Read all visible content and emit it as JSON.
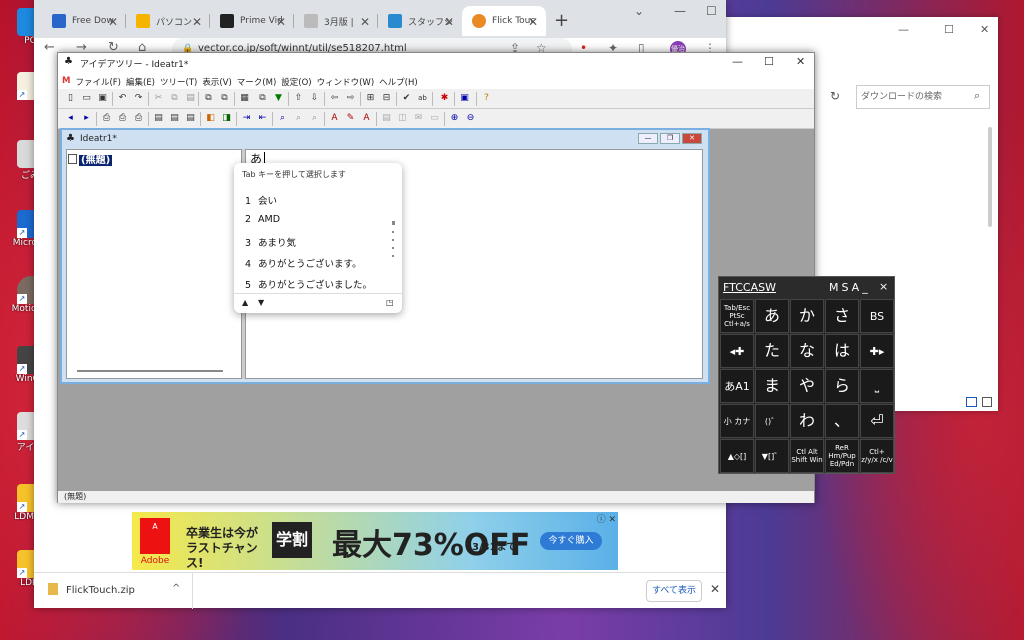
{
  "desktop": {
    "icons": [
      {
        "label": "PC",
        "color": "#1d8ae0"
      },
      {
        "label": "",
        "color": "#f6f0e0"
      },
      {
        "label": "ごみ",
        "color": "#d9d9d9"
      },
      {
        "label": "Microso",
        "color": "#1a6ad0"
      },
      {
        "label": "MotionA",
        "color": "#7a6a60"
      },
      {
        "label": "WinCo",
        "color": "#444"
      },
      {
        "label": "アイデ",
        "color": "#ddd"
      },
      {
        "label": "LDMult",
        "color": "#f6c22b"
      },
      {
        "label": "LDPl",
        "color": "#f6c22b"
      }
    ]
  },
  "chrome": {
    "tabs": [
      {
        "label": "Free Dow",
        "fav": "#2a66c9"
      },
      {
        "label": "パソコン - ",
        "fav": "#f5b400"
      },
      {
        "label": "Prime Vid",
        "fav": "#222"
      },
      {
        "label": "3月版 | ",
        "fav": "#bbb"
      },
      {
        "label": "スタッフシ",
        "fav": "#2a8ad0"
      },
      {
        "label": "Flick Touc",
        "fav": "#e98a24"
      }
    ],
    "url": "vector.co.jp/soft/winnt/util/se518207.html",
    "profile_label": "優治",
    "ad": {
      "brand": "Adobe",
      "headline": "卒業生は今が ラストチャンス!",
      "product": "学割",
      "big": "最大73%OFF",
      "date": "3/31まで",
      "cta": "今すぐ購入"
    },
    "downloads": {
      "file": "FlickTouch.zip",
      "show_all": "すべて表示"
    }
  },
  "explorer": {
    "search_placeholder": "ダウンロードの検索"
  },
  "ideatree": {
    "title": "アイデアツリー - Ideatr1*",
    "menu": [
      "ファイル(F)",
      "編集(E)",
      "ツリー(T)",
      "表示(V)",
      "マーク(M)",
      "設定(O)",
      "ウィンドウ(W)",
      "ヘルプ(H)"
    ],
    "child_title": "Ideatr1*",
    "tree_node": "(無題)",
    "input_text": "あ",
    "status": "(無題)"
  },
  "ime": {
    "hint": "Tab キーを押して選択します",
    "candidates": [
      {
        "n": "1",
        "text": "会い"
      },
      {
        "n": "2",
        "text": "AMD"
      },
      {
        "n": "3",
        "text": "あまり気"
      },
      {
        "n": "4",
        "text": "ありがとうございます。"
      },
      {
        "n": "5",
        "text": "ありがとうございました。"
      }
    ]
  },
  "keyboard": {
    "left_label": "FTCCASW",
    "right_label": "MSA_",
    "close": "×",
    "keys": [
      [
        "Tab/Esc PtSc Ctl+a/s",
        "あ",
        "か",
        "さ",
        "BS"
      ],
      [
        "◂✚",
        "た",
        "な",
        "は",
        "✚▸"
      ],
      [
        "あA1",
        "ま",
        "や",
        "ら",
        "⎵"
      ],
      [
        "小 カナ",
        "()゛",
        "わ",
        "、",
        "⏎"
      ],
      [
        "▲◇[]",
        "▼[]゛",
        "Ctl Alt Shift Win",
        "ReR Hm/Pup Ed/Pdn",
        "Ctl+ z/y/x /c/v"
      ]
    ]
  }
}
